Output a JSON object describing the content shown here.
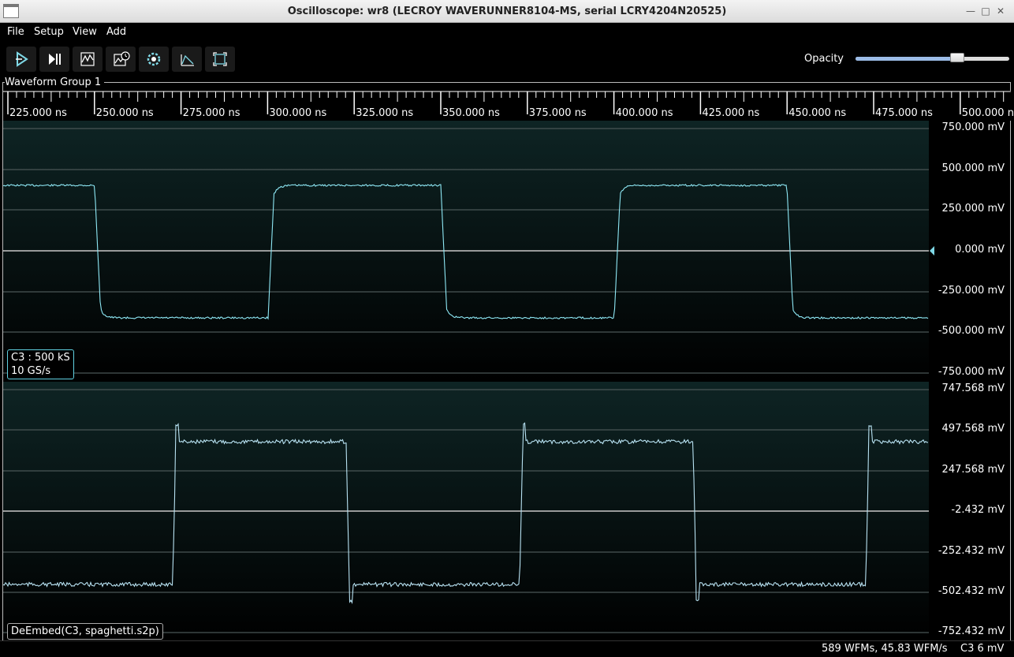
{
  "window": {
    "title": "Oscilloscope: wr8 (LECROY WAVERUNNER8104-MS, serial LCRY4204N20525)",
    "controls": [
      "minimize-icon",
      "maximize-icon",
      "close-icon"
    ]
  },
  "menu": [
    "File",
    "Setup",
    "View",
    "Add"
  ],
  "toolbar": {
    "buttons": [
      "trigger-run-icon",
      "trigger-single-icon",
      "waveform-icon",
      "history-icon",
      "settings-icon",
      "measure-icon",
      "fullscreen-icon"
    ]
  },
  "opacity": {
    "label": "Opacity",
    "value": 0.66
  },
  "group": {
    "label": "Waveform Group 1"
  },
  "timeline": {
    "labels": [
      "225.000 ns",
      "250.000 ns",
      "275.000 ns",
      "300.000 ns",
      "325.000 ns",
      "350.000 ns",
      "375.000 ns",
      "400.000 ns",
      "425.000 ns",
      "450.000 ns",
      "475.000 ns",
      "500.000 ns"
    ]
  },
  "plots": [
    {
      "channel_line1": "C3 : 500 kS",
      "channel_line2": "10 GS/s",
      "y_labels": [
        "750.000 mV",
        "500.000 mV",
        "250.000 mV",
        "0.000 mV",
        "-250.000 mV",
        "-500.000 mV",
        "-750.000 mV"
      ],
      "trace_color": "#8ee8f5"
    },
    {
      "channel_line1": "DeEmbed(C3, spaghetti.s2p)",
      "y_labels": [
        "747.568 mV",
        "497.568 mV",
        "247.568 mV",
        "-2.432 mV",
        "-252.432 mV",
        "-502.432 mV",
        "-752.432 mV"
      ],
      "trace_color": "#b8e2f2"
    }
  ],
  "status": {
    "rate": "589 WFMs, 45.83 WFM/s",
    "channel": "C3 6 mV"
  }
}
